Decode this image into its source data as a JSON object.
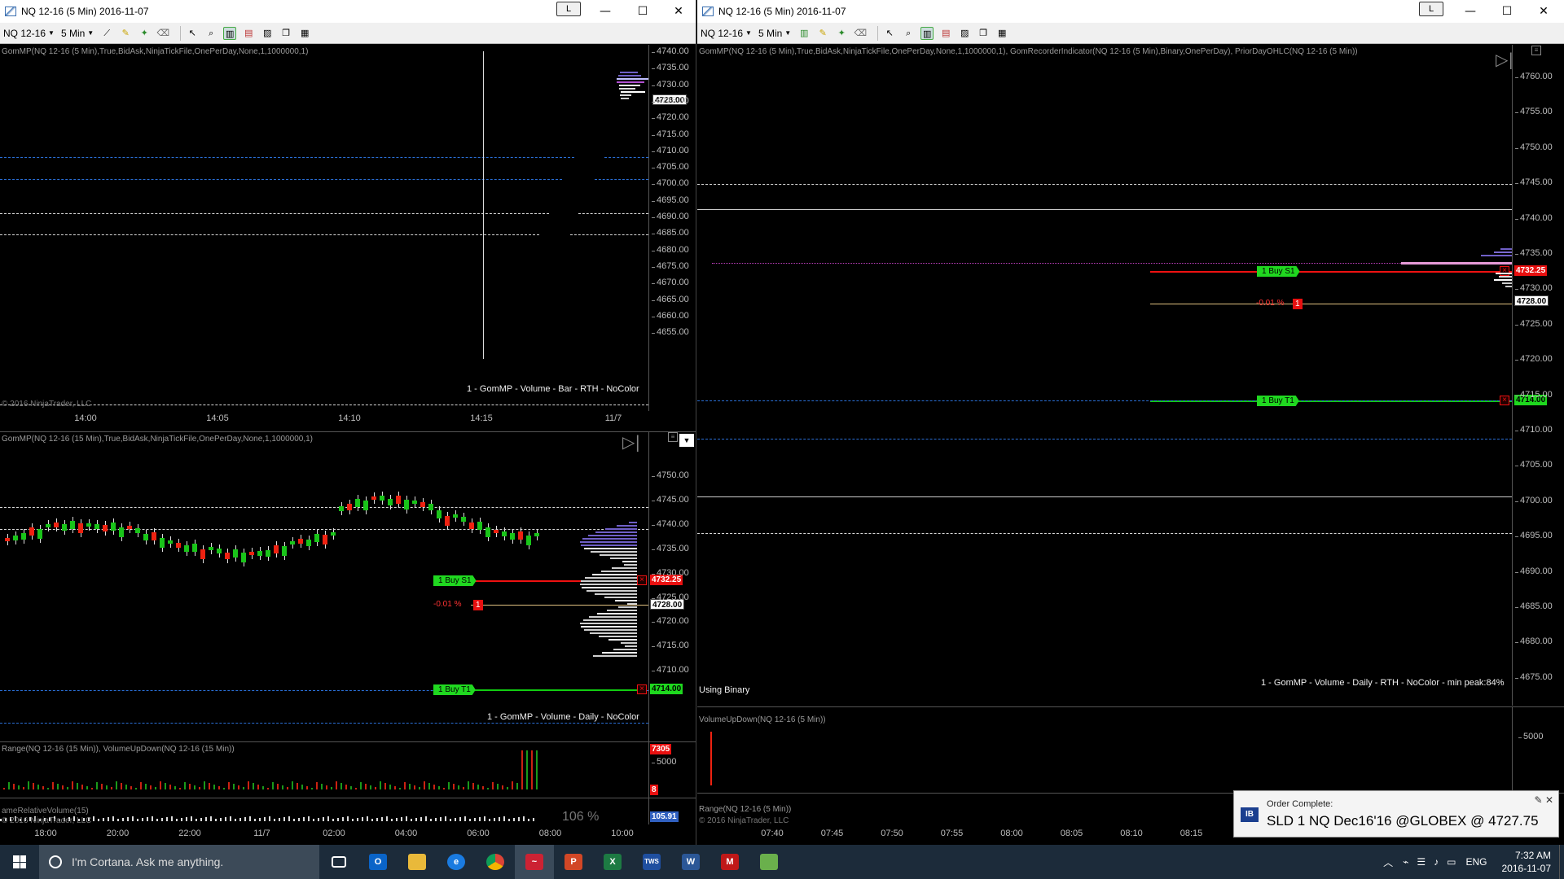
{
  "left_window": {
    "title": "NQ 12-16 (5 Min)  2016-11-07",
    "link_label": "L",
    "toolbar": {
      "instrument": "NQ 12-16",
      "interval": "5 Min"
    },
    "top_panel": {
      "label": "GomMP(NQ 12-16 (5 Min),True,BidAsk,NinjaTickFile,OnePerDay,None,1,1000000,1)",
      "ticks": [
        "4740.00",
        "4735.00",
        "4730.00",
        "4725.00",
        "4720.00",
        "4715.00",
        "4710.00",
        "4705.00",
        "4700.00",
        "4695.00",
        "4690.00",
        "4685.00",
        "4680.00",
        "4675.00",
        "4670.00",
        "4665.00",
        "4660.00",
        "4655.00"
      ],
      "last_price": "4728.00",
      "note": "1 - GomMP  - Volume - Bar - RTH - NoColor",
      "copyright": "© 2016 NinjaTrader, LLC",
      "x_ticks": [
        "14:00",
        "14:05",
        "14:10",
        "14:15",
        "11/7"
      ]
    },
    "mid_panel": {
      "label": "GomMP(NQ 12-16 (15 Min),True,BidAsk,NinjaTickFile,OnePerDay,None,1,1000000,1)",
      "ticks": [
        "4750.00",
        "4745.00",
        "4740.00",
        "4735.00",
        "4730.00",
        "4725.00",
        "4720.00",
        "4715.00",
        "4710.00"
      ],
      "sell_price": "4732.25",
      "last_price": "4728.00",
      "target_price": "4714.00",
      "stop_label": "1  Buy S1",
      "target_label": "1  Buy T1",
      "pnl": "-0.01 %",
      "qty": "1",
      "note": "1 - GomMP  - Volume - Daily - NoColor"
    },
    "volume_panel": {
      "label": "Range(NQ 12-16 (15 Min)), VolumeUpDown(NQ 12-16 (15 Min))",
      "ticks": [
        "7305",
        "5000"
      ],
      "range_value": "8"
    },
    "relvol_panel": {
      "label": "ameRelativeVolume(15)",
      "percent": "106 %",
      "value": "105.91",
      "copyright": "© 2016 NinjaTrader, LLC",
      "x_ticks": [
        "18:00",
        "20:00",
        "22:00",
        "11/7",
        "02:00",
        "04:00",
        "06:00",
        "08:00",
        "10:00"
      ]
    }
  },
  "right_window": {
    "title": "NQ 12-16 (5 Min)  2016-11-07",
    "link_label": "L",
    "toolbar": {
      "instrument": "NQ 12-16",
      "interval": "5 Min"
    },
    "main_panel": {
      "label": "GomMP(NQ 12-16 (5 Min),True,BidAsk,NinjaTickFile,OnePerDay,None,1,1000000,1), GomRecorderIndicator(NQ 12-16 (5 Min),Binary,OnePerDay), PriorDayOHLC(NQ 12-16 (5 Min))",
      "ticks": [
        "4760.00",
        "4755.00",
        "4750.00",
        "4745.00",
        "4740.00",
        "4735.00",
        "4730.00",
        "4725.00",
        "4720.00",
        "4715.00",
        "4710.00",
        "4705.00",
        "4700.00",
        "4695.00",
        "4690.00",
        "4685.00",
        "4680.00",
        "4675.00"
      ],
      "sell_price": "4732.25",
      "last_price": "4728.00",
      "target_price": "4714.00",
      "stop_label": "1  Buy S1",
      "target_label": "1  Buy T1",
      "pnl": "-0.01 %",
      "qty": "1",
      "using": "Using Binary",
      "note": "1 - GomMP  - Volume - Daily - RTH - NoColor - min peak:84%"
    },
    "volume_panel": {
      "label": "VolumeUpDown(NQ 12-16 (5 Min))",
      "ticks": [
        "5000"
      ]
    },
    "range_panel": {
      "label": "Range(NQ 12-16 (5 Min))",
      "copyright": "© 2016 NinjaTrader, LLC",
      "x_ticks": [
        "07:40",
        "07:45",
        "07:50",
        "07:55",
        "08:00",
        "08:05",
        "08:10",
        "08:15"
      ]
    }
  },
  "toast": {
    "badge": "IB",
    "title": "Order Complete:",
    "message": "SLD 1 NQ Dec16'16 @GLOBEX @ 4727.75"
  },
  "taskbar": {
    "search_placeholder": "I'm Cortana. Ask me anything.",
    "apps": [
      "task-view",
      "outlook",
      "file-explorer",
      "edge",
      "chrome",
      "ninjatrader",
      "powerpoint",
      "excel",
      "tws",
      "word",
      "mcafee",
      "green-app"
    ],
    "language": "ENG",
    "time": "7:32 AM",
    "date": "2016-11-07"
  }
}
